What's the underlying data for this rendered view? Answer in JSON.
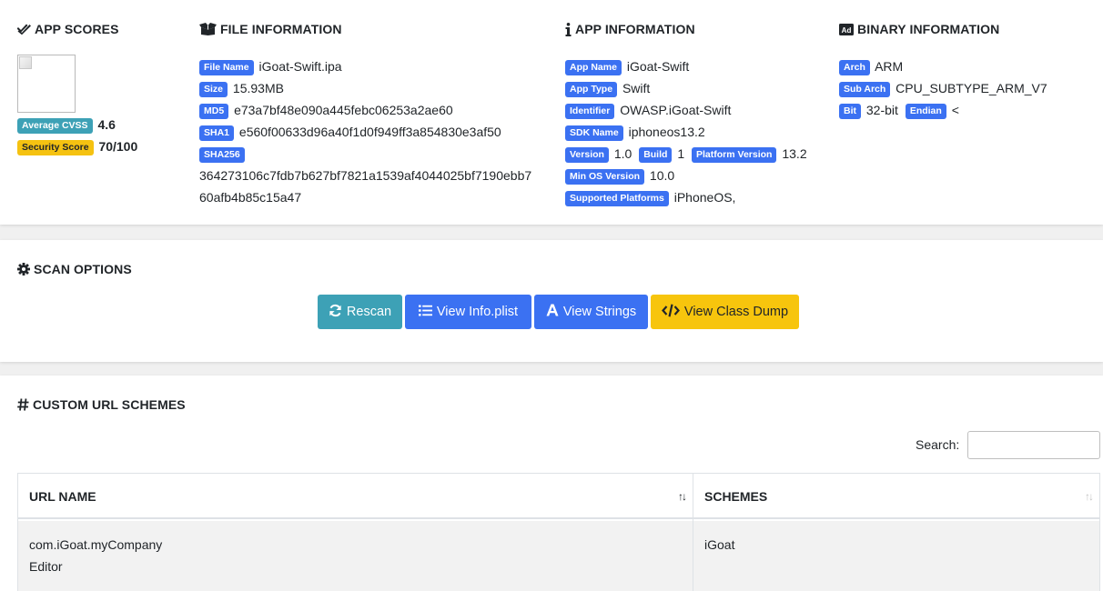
{
  "app_scores": {
    "title": "APP SCORES",
    "avg_cvss_label": "Average CVSS",
    "avg_cvss_value": "4.6",
    "security_score_label": "Security Score",
    "security_score_value": "70/100"
  },
  "file_info": {
    "title": "FILE INFORMATION",
    "file_name_label": "File Name",
    "file_name": "iGoat-Swift.ipa",
    "size_label": "Size",
    "size": "15.93MB",
    "md5_label": "MD5",
    "md5": "e73a7bf48e090a445febc06253a2ae60",
    "sha1_label": "SHA1",
    "sha1": "e560f00633d96a40f1d0f949ff3a854830e3af50",
    "sha256_label": "SHA256",
    "sha256_line1": "364273106c7fdb7b627bf7821a1539af4044025bf7190ebb7",
    "sha256_line2": "60afb4b85c15a47"
  },
  "app_info": {
    "title": "APP INFORMATION",
    "app_name_label": "App Name",
    "app_name": "iGoat-Swift",
    "app_type_label": "App Type",
    "app_type": "Swift",
    "identifier_label": "Identifier",
    "identifier": "OWASP.iGoat-Swift",
    "sdk_name_label": "SDK Name",
    "sdk_name": "iphoneos13.2",
    "version_label": "Version",
    "version": "1.0",
    "build_label": "Build",
    "build": "1",
    "platform_version_label": "Platform Version",
    "platform_version": "13.2",
    "min_os_label": "Min OS Version",
    "min_os": "10.0",
    "supported_platforms_label": "Supported Platforms",
    "supported_platforms": "iPhoneOS,"
  },
  "binary_info": {
    "title": "BINARY INFORMATION",
    "arch_label": "Arch",
    "arch": "ARM",
    "sub_arch_label": "Sub Arch",
    "sub_arch": "CPU_SUBTYPE_ARM_V7",
    "bit_label": "Bit",
    "bit": "32-bit",
    "endian_label": "Endian",
    "endian": "<"
  },
  "scan_options": {
    "title": "SCAN OPTIONS",
    "rescan_label": "Rescan",
    "view_info_plist_label": "View Info.plist",
    "view_strings_label": "View Strings",
    "view_class_dump_label": "View Class Dump"
  },
  "url_schemes": {
    "title": "CUSTOM URL SCHEMES",
    "search_label": "Search:",
    "search_value": "",
    "columns": [
      "URL NAME",
      "SCHEMES"
    ],
    "rows": [
      {
        "url_name_line1": "com.iGoat.myCompany",
        "url_name_line2": "Editor",
        "schemes": "iGoat"
      }
    ]
  },
  "colors": {
    "badge_blue": "#3b71f2",
    "badge_teal": "#3da1b6",
    "badge_yellow": "#f5c211",
    "button_yellow": "#f7c50d"
  },
  "icons": {
    "app_scores": "check-double-icon",
    "file_info": "box-open-icon",
    "app_info": "info-icon",
    "binary_info": "ad-icon",
    "scan_options": "cog-icon",
    "rescan": "sync-icon",
    "info_plist": "list-icon",
    "strings": "font-icon",
    "class_dump": "code-icon",
    "url_schemes": "hashtag-icon"
  }
}
